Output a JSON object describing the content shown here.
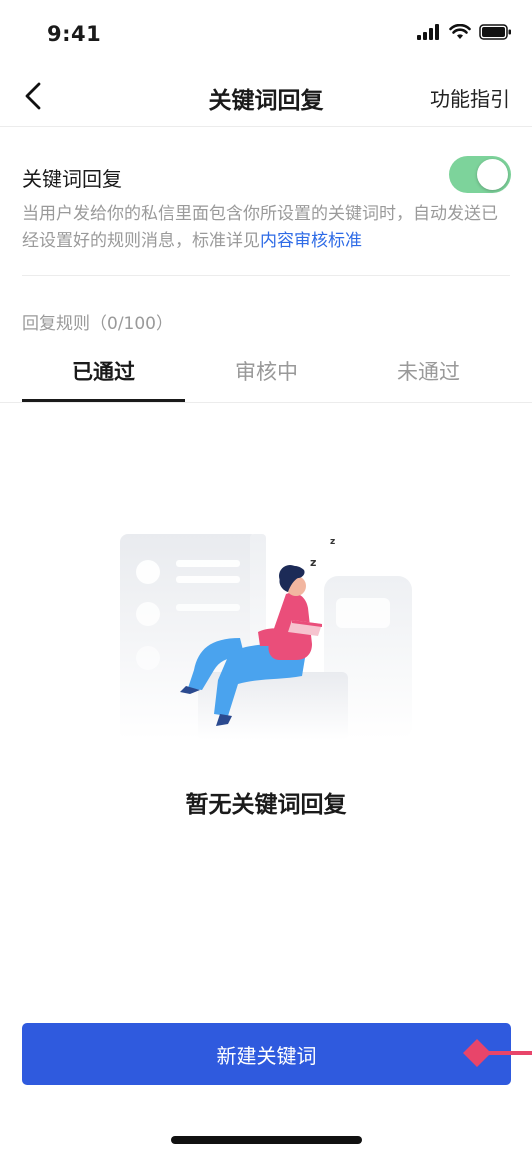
{
  "status_bar": {
    "time": "9:41",
    "icons": [
      "signal-icon",
      "wifi-icon",
      "battery-icon"
    ]
  },
  "nav": {
    "back_icon": "chevron-left-icon",
    "title": "关键词回复",
    "right_action": "功能指引"
  },
  "setting": {
    "title": "关键词回复",
    "toggle_on": true,
    "description": "当用户发给你的私信里面包含你所设置的关键词时，自动发送已经设置好的规则消息，标准详见",
    "description_link": "内容审核标准"
  },
  "rules": {
    "label": "回复规则（0/100）"
  },
  "tabs": [
    {
      "label": "已通过",
      "active": true
    },
    {
      "label": "审核中",
      "active": false
    },
    {
      "label": "未通过",
      "active": false
    }
  ],
  "empty_state": {
    "text": "暂无关键词回复"
  },
  "primary_button": {
    "label": "新建关键词"
  },
  "colors": {
    "accent": "#2f5ade",
    "link": "#2e6be6",
    "toggle_on": "#7dd39b",
    "pointer": "#e8456a"
  }
}
